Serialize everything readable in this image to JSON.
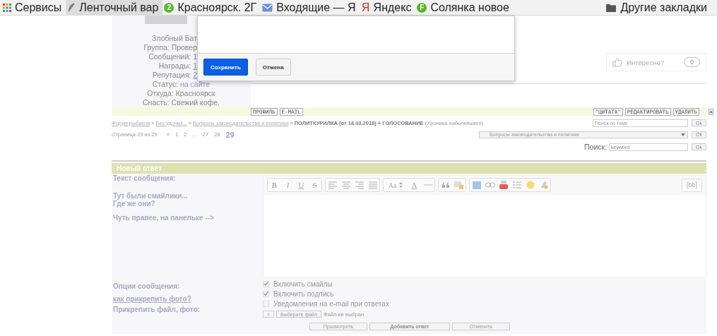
{
  "bookmarks": [
    {
      "label": "Сервисы",
      "kind": "grid",
      "selected": false
    },
    {
      "label": "Ленточный вар",
      "kind": "feather",
      "selected": true
    },
    {
      "label": "Красноярск. 2Г",
      "kind": "badge",
      "badge": "2",
      "color": "#5cb82e",
      "selected": false
    },
    {
      "label": "Входящие — Я",
      "kind": "mail",
      "selected": false
    },
    {
      "label": "Яндекс",
      "kind": "letter",
      "badge": "Я",
      "color": "#e52620",
      "selected": false
    },
    {
      "label": "Солянка новое",
      "kind": "badge",
      "badge": "F",
      "color": "#56b52c",
      "selected": false
    }
  ],
  "other_bookmarks": "Другие закладки",
  "profile": {
    "cut_lines": [
      {
        "label": "Злобный Бат"
      },
      {
        "label": "Группа: Провер"
      },
      {
        "label": "Сообщений: 1"
      },
      {
        "label": "Награды: ",
        "link": "1"
      },
      {
        "label": "Репутация: ",
        "link": "2"
      }
    ],
    "lines": [
      {
        "label": "Статус: ",
        "link": "на сайте"
      },
      {
        "label": "Откуда: Красноярск"
      },
      {
        "label": "Снасть: Свежий кофе."
      }
    ]
  },
  "dialog": {
    "buttons": [
      {
        "label": "Сохранить",
        "kind": "primary"
      },
      {
        "label": "Отмена",
        "kind": "secondary"
      }
    ]
  },
  "like": {
    "label": "Интересно?",
    "count": "0"
  },
  "post_actions": {
    "left": [
      "ПРОФИЛЬ",
      "E-MAIL"
    ],
    "right": [
      "\"ЦИТАТА\"",
      "РЕДАКТИРОВАТЬ",
      "УДАЛИТЬ"
    ]
  },
  "breadcrumb": {
    "links": [
      "Форум рыбаков",
      "Без удочки...",
      "Вопросы законодательства и политики"
    ],
    "separator": "»",
    "title": "ПОЛИТКУРИЛКА (от 18.03.2018) + ГОЛОСОВАНИЕ",
    "subtitle": "(Хроника наболевшего)"
  },
  "topic_search": {
    "placeholder": "Поиск по теме",
    "button": "Ok"
  },
  "pagination": {
    "label": "Страница 29 из 29",
    "pages": [
      {
        "label": "«",
        "selected": false
      },
      {
        "label": "1",
        "selected": false
      },
      {
        "label": "2",
        "selected": false
      },
      {
        "label": "...",
        "selected": false
      },
      {
        "label": "27",
        "selected": false
      },
      {
        "label": "28",
        "selected": false
      },
      {
        "label": "29",
        "selected": true
      }
    ]
  },
  "forum_select": {
    "value": "Вопросы законодательства и политики",
    "button": "Ok"
  },
  "search": {
    "label": "Поиск:",
    "value": "keyword",
    "button": "Ok"
  },
  "reply": {
    "title": "Новый ответ",
    "labels": [
      {
        "label": "Текст сообщения:"
      },
      {
        "label": "Тут были смайлики...\nГде же они?"
      },
      {
        "label": "Чуть правее, на панельке -->"
      }
    ],
    "toolbar_letters": [
      "B",
      "I",
      "U",
      "S"
    ],
    "font_size": "Aa",
    "font_color": "A",
    "source_button": "[bb]",
    "options_label": "Опции сообщения:",
    "help_link": "как прикрепить фото?",
    "options": [
      {
        "label": "Включить смайлы",
        "checked": true
      },
      {
        "label": "Включить подпись",
        "checked": true
      },
      {
        "label": "Уведомления на e-mail при ответах",
        "checked": false
      }
    ],
    "attach_label": "Прикрепить файл, фото:",
    "attach_add": "+",
    "attach_choose": "Выберите файл",
    "attach_status": "Файл не выбран",
    "buttons": [
      {
        "label": "Просмотреть",
        "kind": "normal"
      },
      {
        "label": "Добавить ответ",
        "kind": "main"
      },
      {
        "label": "Отменить",
        "kind": "normal"
      }
    ]
  }
}
